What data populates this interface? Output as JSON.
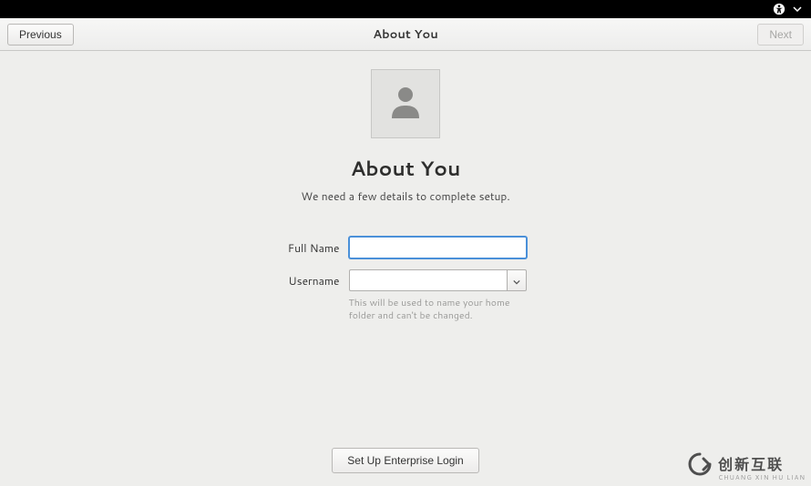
{
  "topbar": {
    "a11y_icon": "accessibility-icon",
    "dropdown_icon": "chevron-down-icon"
  },
  "header": {
    "title": "About You",
    "previous_label": "Previous",
    "next_label": "Next"
  },
  "page": {
    "heading": "About You",
    "subheading": "We need a few details to complete setup."
  },
  "form": {
    "full_name_label": "Full Name",
    "full_name_value": "",
    "username_label": "Username",
    "username_value": "",
    "username_hint": "This will be used to name your home folder and can't be changed."
  },
  "footer": {
    "enterprise_label": "Set Up Enterprise Login"
  },
  "watermark": {
    "cn": "创新互联",
    "en": "CHUANG XIN HU LIAN"
  }
}
